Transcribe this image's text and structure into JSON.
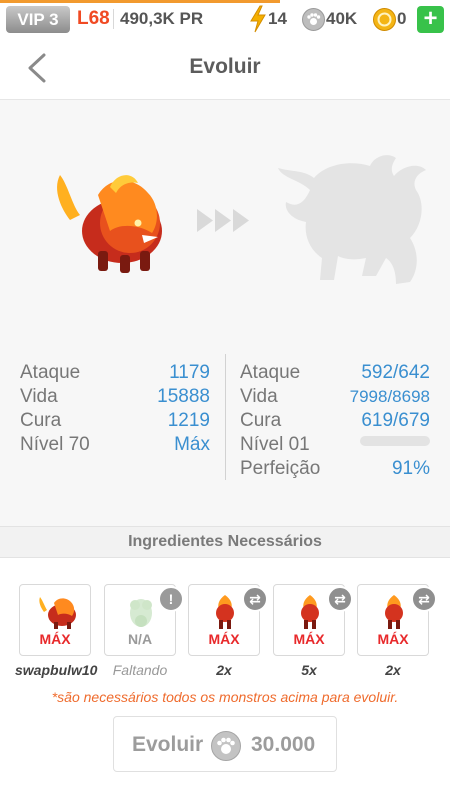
{
  "status_bar": {
    "vip": "VIP 3",
    "level": "L68",
    "power": "490,3K PR",
    "energy": "14",
    "paw_coins": "40K",
    "gold": "0",
    "add_label": "+"
  },
  "header": {
    "title": "Evoluir"
  },
  "stats_current": {
    "rows": [
      {
        "label": "Ataque",
        "value": "1179"
      },
      {
        "label": "Vida",
        "value": "15888"
      },
      {
        "label": "Cura",
        "value": "1219"
      },
      {
        "label": "Nível 70",
        "value": "Máx"
      }
    ]
  },
  "stats_evolved": {
    "rows": [
      {
        "label": "Ataque",
        "value": "592/642"
      },
      {
        "label": "Vida",
        "value": "7998/8698"
      },
      {
        "label": "Cura",
        "value": "619/679"
      },
      {
        "label": "Nível 01",
        "value": ""
      },
      {
        "label": "Perfeição",
        "value": "91%"
      }
    ],
    "level_progress": 0
  },
  "ingredients": {
    "title": "Ingredientes Necessários",
    "items": [
      {
        "tag": "MÁX",
        "caption": "swapbulw10",
        "badge": ""
      },
      {
        "tag": "N/A",
        "caption": "Faltando",
        "badge": "!"
      },
      {
        "tag": "MÁX",
        "caption": "2x",
        "badge": "swap"
      },
      {
        "tag": "MÁX",
        "caption": "5x",
        "badge": "swap"
      },
      {
        "tag": "MÁX",
        "caption": "2x",
        "badge": "swap"
      }
    ],
    "note": "*são necessários todos os monstros acima para evoluir."
  },
  "evolve": {
    "label": "Evoluir",
    "cost": "30.000"
  },
  "colors": {
    "accent": "#3a8fd0",
    "max_red": "#e8292b",
    "note_orange": "#ef6b2d",
    "level_orange": "#f04a23",
    "add_green": "#38c24a"
  }
}
